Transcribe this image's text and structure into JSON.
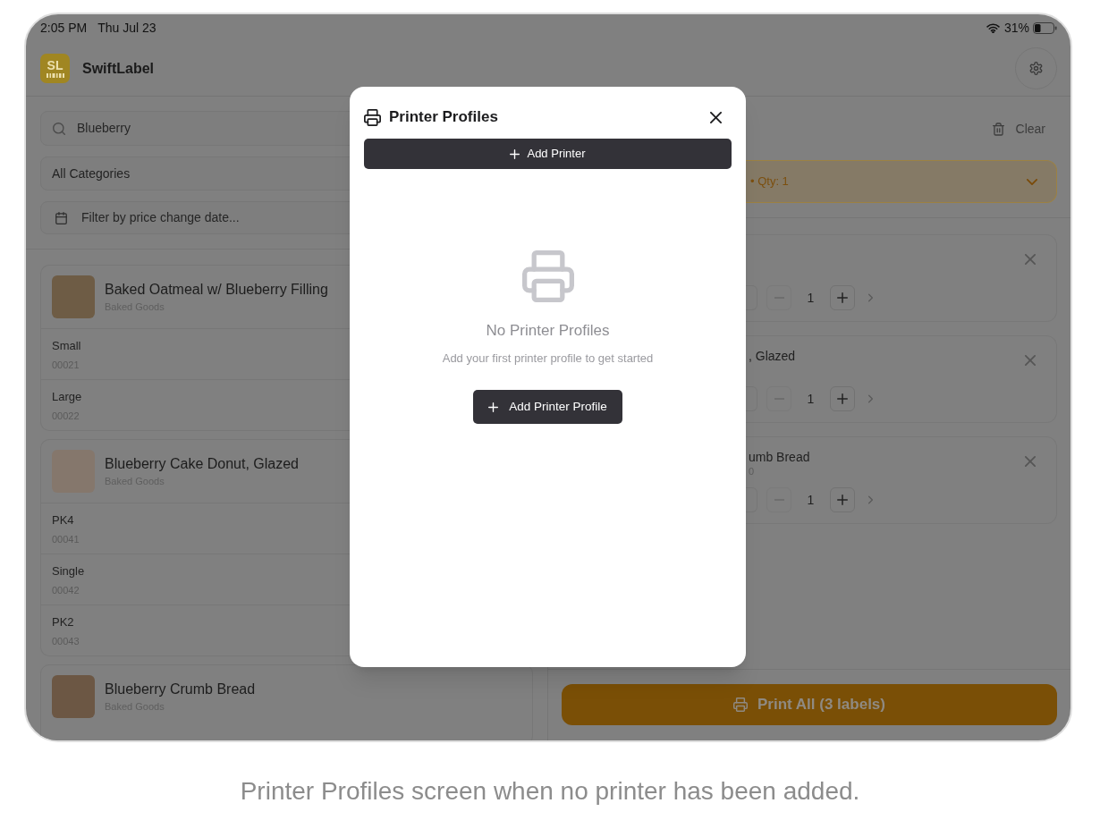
{
  "status_bar": {
    "time": "2:05 PM",
    "date": "Thu Jul 23",
    "battery": "31%"
  },
  "header": {
    "logo_text": "SL",
    "app_name": "SwiftLabel"
  },
  "filters": {
    "search": {
      "value": "Blueberry"
    },
    "category": {
      "value": "All Categories"
    },
    "date_filter": {
      "label": "Filter by price change date..."
    }
  },
  "products": [
    {
      "name": "Baked Oatmeal w/ Blueberry Filling",
      "category": "Baked Goods",
      "variants": [
        {
          "name": "Small",
          "code": "00021"
        },
        {
          "name": "Large",
          "code": "00022"
        }
      ]
    },
    {
      "name": "Blueberry Cake Donut, Glazed",
      "category": "Baked Goods",
      "variants": [
        {
          "name": "PK4",
          "code": "00041"
        },
        {
          "name": "Single",
          "code": "00042"
        },
        {
          "name": "PK2",
          "code": "00043"
        }
      ]
    },
    {
      "name": "Blueberry Crumb Bread",
      "category": "Baked Goods"
    }
  ],
  "queue": {
    "clear": "Clear",
    "summary": {
      "text": "• Qty: 1",
      "expanded": false
    },
    "items": [
      {
        "quantity": "1"
      },
      {
        "title": ", Glazed",
        "quantity": "1"
      },
      {
        "title": "umb Bread",
        "subtitle": "0",
        "quantity": "1"
      }
    ],
    "print_button": "Print All (3 labels)"
  },
  "dialog": {
    "title": "Printer Profiles",
    "add_button": "Add Printer",
    "empty_state": {
      "title": "No Printer Profiles",
      "message": "Add your first printer profile to get started",
      "button": "Add Printer Profile"
    }
  },
  "caption": "Printer Profiles screen when no printer has been added."
}
